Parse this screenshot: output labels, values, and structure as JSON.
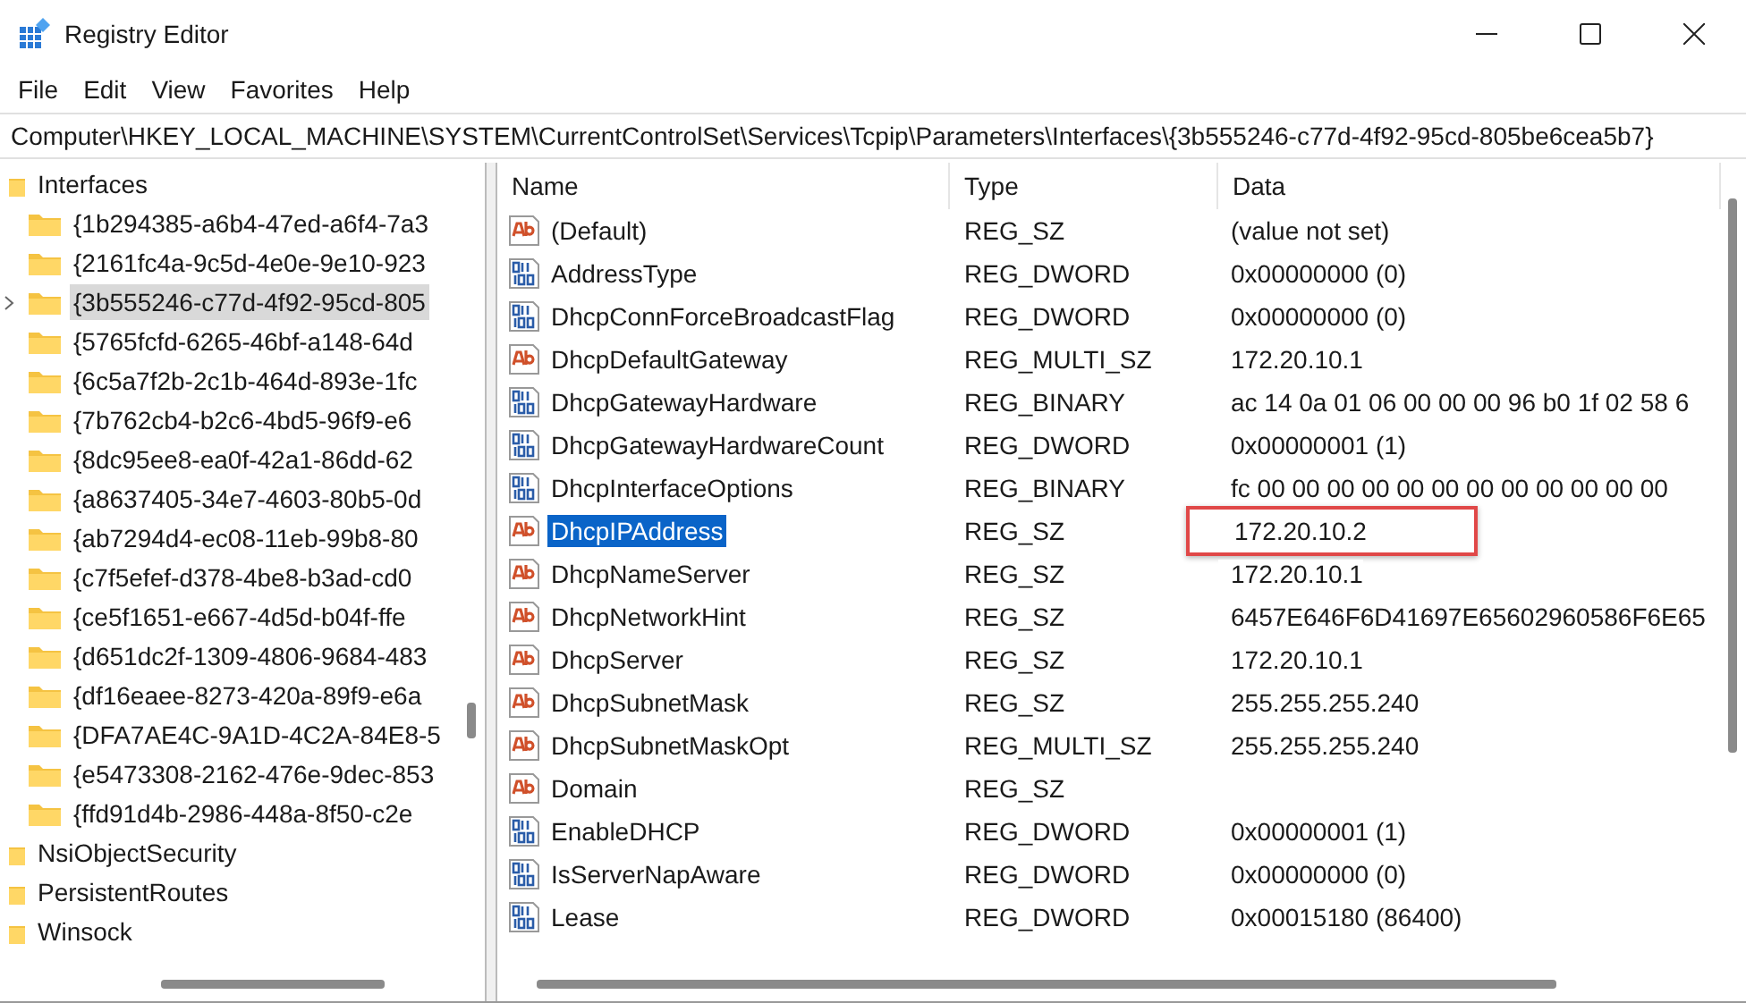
{
  "window": {
    "title": "Registry Editor"
  },
  "menu": [
    {
      "label": "File"
    },
    {
      "label": "Edit"
    },
    {
      "label": "View"
    },
    {
      "label": "Favorites"
    },
    {
      "label": "Help"
    }
  ],
  "address": "Computer\\HKEY_LOCAL_MACHINE\\SYSTEM\\CurrentControlSet\\Services\\Tcpip\\Parameters\\Interfaces\\{3b555246-c77d-4f92-95cd-805be6cea5b7}",
  "tree": [
    {
      "label": "Interfaces",
      "selected": false,
      "children": [
        {
          "label": "{1b294385-a6b4-47ed-a6f4-7a3",
          "selected": false
        },
        {
          "label": "{2161fc4a-9c5d-4e0e-9e10-923",
          "selected": false
        },
        {
          "label": "{3b555246-c77d-4f92-95cd-805",
          "selected": true
        },
        {
          "label": "{5765fcfd-6265-46bf-a148-64d",
          "selected": false
        },
        {
          "label": "{6c5a7f2b-2c1b-464d-893e-1fc",
          "selected": false
        },
        {
          "label": "{7b762cb4-b2c6-4bd5-96f9-e6",
          "selected": false
        },
        {
          "label": "{8dc95ee8-ea0f-42a1-86dd-62",
          "selected": false
        },
        {
          "label": "{a8637405-34e7-4603-80b5-0d",
          "selected": false
        },
        {
          "label": "{ab7294d4-ec08-11eb-99b8-80",
          "selected": false
        },
        {
          "label": "{c7f5efef-d378-4be8-b3ad-cd0",
          "selected": false
        },
        {
          "label": "{ce5f1651-e667-4d5d-b04f-ffe",
          "selected": false
        },
        {
          "label": "{d651dc2f-1309-4806-9684-483",
          "selected": false
        },
        {
          "label": "{df16eaee-8273-420a-89f9-e6a",
          "selected": false
        },
        {
          "label": "{DFA7AE4C-9A1D-4C2A-84E8-5",
          "selected": false
        },
        {
          "label": "{e5473308-2162-476e-9dec-853",
          "selected": false
        },
        {
          "label": "{ffd91d4b-2986-448a-8f50-c2e",
          "selected": false
        }
      ]
    },
    {
      "label": "NsiObjectSecurity",
      "selected": false
    },
    {
      "label": "PersistentRoutes",
      "selected": false
    },
    {
      "label": "Winsock",
      "selected": false
    }
  ],
  "table": {
    "columns": [
      "Name",
      "Type",
      "Data"
    ],
    "rows": [
      {
        "kind": "string",
        "name": "(Default)",
        "type": "REG_SZ",
        "data": "(value not set)",
        "selected": false,
        "highlighted": false
      },
      {
        "kind": "binary",
        "name": "AddressType",
        "type": "REG_DWORD",
        "data": "0x00000000 (0)",
        "selected": false,
        "highlighted": false
      },
      {
        "kind": "binary",
        "name": "DhcpConnForceBroadcastFlag",
        "type": "REG_DWORD",
        "data": "0x00000000 (0)",
        "selected": false,
        "highlighted": false
      },
      {
        "kind": "string",
        "name": "DhcpDefaultGateway",
        "type": "REG_MULTI_SZ",
        "data": "172.20.10.1",
        "selected": false,
        "highlighted": false
      },
      {
        "kind": "binary",
        "name": "DhcpGatewayHardware",
        "type": "REG_BINARY",
        "data": "ac 14 0a 01 06 00 00 00 96 b0 1f 02 58 6",
        "selected": false,
        "highlighted": false
      },
      {
        "kind": "binary",
        "name": "DhcpGatewayHardwareCount",
        "type": "REG_DWORD",
        "data": "0x00000001 (1)",
        "selected": false,
        "highlighted": false
      },
      {
        "kind": "binary",
        "name": "DhcpInterfaceOptions",
        "type": "REG_BINARY",
        "data": "fc 00 00 00 00 00 00 00 00 00 00 00 00",
        "selected": false,
        "highlighted": false
      },
      {
        "kind": "string",
        "name": "DhcpIPAddress",
        "type": "REG_SZ",
        "data": "172.20.10.2",
        "selected": true,
        "highlighted": true
      },
      {
        "kind": "string",
        "name": "DhcpNameServer",
        "type": "REG_SZ",
        "data": "172.20.10.1",
        "selected": false,
        "highlighted": false
      },
      {
        "kind": "string",
        "name": "DhcpNetworkHint",
        "type": "REG_SZ",
        "data": "6457E646F6D41697E65602960586F6E65",
        "selected": false,
        "highlighted": false
      },
      {
        "kind": "string",
        "name": "DhcpServer",
        "type": "REG_SZ",
        "data": "172.20.10.1",
        "selected": false,
        "highlighted": false
      },
      {
        "kind": "string",
        "name": "DhcpSubnetMask",
        "type": "REG_SZ",
        "data": "255.255.255.240",
        "selected": false,
        "highlighted": false
      },
      {
        "kind": "string",
        "name": "DhcpSubnetMaskOpt",
        "type": "REG_MULTI_SZ",
        "data": "255.255.255.240",
        "selected": false,
        "highlighted": false
      },
      {
        "kind": "string",
        "name": "Domain",
        "type": "REG_SZ",
        "selected": false,
        "highlighted": false
      },
      {
        "kind": "binary",
        "name": "EnableDHCP",
        "type": "REG_DWORD",
        "data": "0x00000001 (1)",
        "selected": false,
        "highlighted": false
      },
      {
        "kind": "binary",
        "name": "IsServerNapAware",
        "type": "REG_DWORD",
        "data": "0x00000000 (0)",
        "selected": false,
        "highlighted": false
      },
      {
        "kind": "binary",
        "name": "Lease",
        "type": "REG_DWORD",
        "data": "0x00015180 (86400)",
        "selected": false,
        "highlighted": false
      }
    ]
  }
}
